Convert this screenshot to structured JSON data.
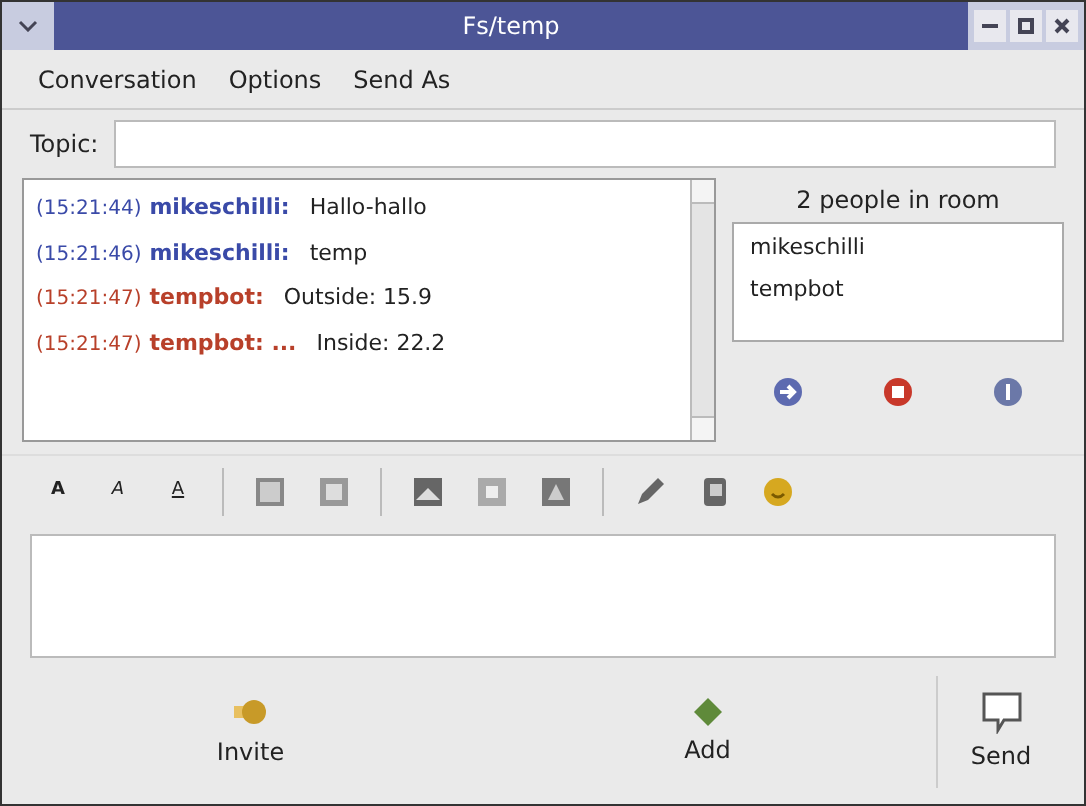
{
  "window": {
    "title": "Fs/temp"
  },
  "menu": [
    "Conversation",
    "Options",
    "Send As"
  ],
  "topic": {
    "label": "Topic:"
  },
  "messages": [
    {
      "time": "(15:21:44)",
      "sender": "mikeschilli:",
      "text": "Hallo-hallo",
      "color": "#3a4aa8"
    },
    {
      "time": "(15:21:46)",
      "sender": "mikeschilli:",
      "text": "temp",
      "color": "#3a4aa8"
    },
    {
      "time": "(15:21:47)",
      "sender": "tempbot:",
      "text": "Outside: 15.9",
      "color": "#b8402a"
    },
    {
      "time": "(15:21:47)",
      "sender": "tempbot: ...",
      "text": "Inside: 22.2",
      "color": "#b8402a"
    }
  ],
  "people": {
    "count": "2 people in room",
    "members": [
      "mikeschilli",
      "tempbot"
    ]
  },
  "format_buttons": [
    "A",
    "A",
    "A"
  ],
  "actions": [
    {
      "label": "Invite",
      "kind": "invite"
    },
    {
      "label": "Add",
      "kind": "add"
    },
    {
      "label": "Send",
      "kind": "send"
    }
  ]
}
